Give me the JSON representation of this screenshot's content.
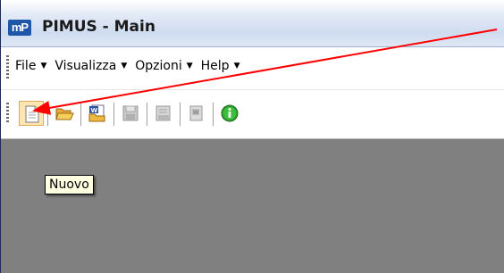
{
  "window": {
    "app_icon_text": "mP",
    "title": "PIMUS - Main"
  },
  "menu": {
    "items": [
      {
        "label": "File",
        "arrow": "▼"
      },
      {
        "label": "Visualizza",
        "arrow": "▼"
      },
      {
        "label": "Opzioni",
        "arrow": "▼"
      },
      {
        "label": "Help",
        "arrow": "▼"
      }
    ]
  },
  "toolbar": {
    "buttons": [
      {
        "icon": "new-document-icon",
        "state": "selected"
      },
      {
        "icon": "open-folder-icon",
        "state": "enabled"
      },
      {
        "icon": "word-open-icon",
        "state": "enabled"
      },
      {
        "icon": "save-icon",
        "state": "disabled"
      },
      {
        "icon": "print-preview-icon",
        "state": "disabled"
      },
      {
        "icon": "word-export-icon",
        "state": "disabled"
      },
      {
        "icon": "info-icon",
        "state": "enabled"
      }
    ]
  },
  "tooltip": {
    "text": "Nuovo"
  },
  "annotation": {
    "arrow_color": "#ff0000"
  },
  "colors": {
    "workspace": "#808080",
    "tooltip_bg": "#ffffe1",
    "selected_button": "#fde6b1"
  }
}
